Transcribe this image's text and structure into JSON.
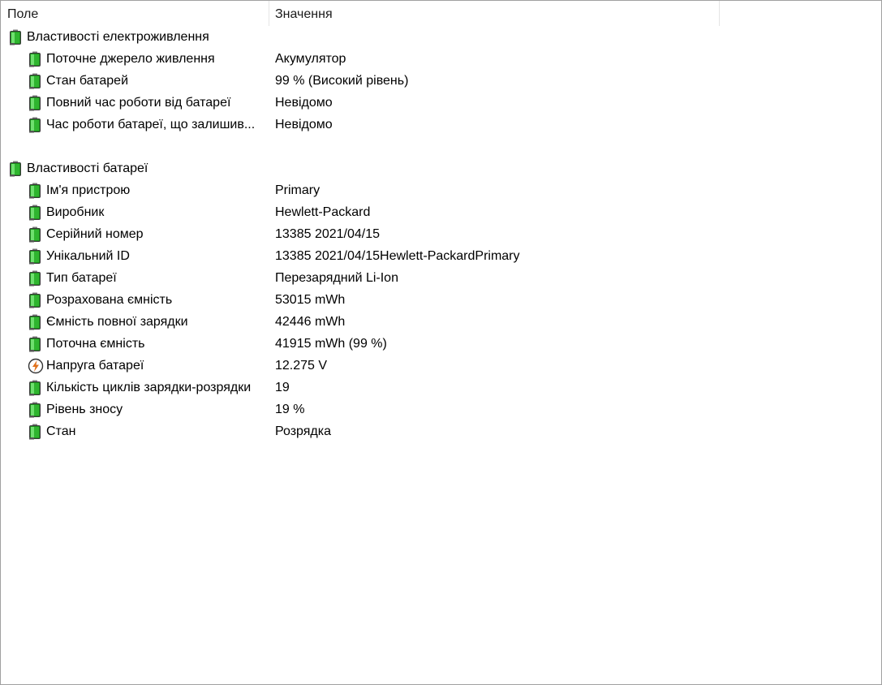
{
  "header": {
    "field_col": "Поле",
    "value_col": "Значення"
  },
  "groups": [
    {
      "title": "Властивості електроживлення",
      "icon": "battery-icon",
      "items": [
        {
          "field": "Поточне джерело живлення",
          "value": "Акумулятор",
          "icon": "battery-icon"
        },
        {
          "field": "Стан батарей",
          "value": "99 % (Високий рівень)",
          "icon": "battery-icon"
        },
        {
          "field": "Повний час роботи від батареї",
          "value": "Невідомо",
          "icon": "battery-icon"
        },
        {
          "field": "Час роботи батареї, що залишив...",
          "value": "Невідомо",
          "icon": "battery-icon"
        }
      ]
    },
    {
      "title": "Властивості батареї",
      "icon": "battery-icon",
      "items": [
        {
          "field": "Ім'я пристрою",
          "value": "Primary",
          "icon": "battery-icon"
        },
        {
          "field": "Виробник",
          "value": "Hewlett-Packard",
          "icon": "battery-icon"
        },
        {
          "field": "Серійний номер",
          "value": "13385 2021/04/15",
          "icon": "battery-icon"
        },
        {
          "field": "Унікальний ID",
          "value": "13385 2021/04/15Hewlett-PackardPrimary",
          "icon": "battery-icon"
        },
        {
          "field": "Тип батареї",
          "value": "Перезарядний Li-Ion",
          "icon": "battery-icon"
        },
        {
          "field": "Розрахована ємність",
          "value": "53015 mWh",
          "icon": "battery-icon"
        },
        {
          "field": "Ємність повної зарядки",
          "value": "42446 mWh",
          "icon": "battery-icon"
        },
        {
          "field": "Поточна ємність",
          "value": "41915 mWh  (99 %)",
          "icon": "battery-icon"
        },
        {
          "field": "Напруга батареї",
          "value": "12.275 V",
          "icon": "voltage-icon"
        },
        {
          "field": "Кількість циклів зарядки-розрядки",
          "value": "19",
          "icon": "battery-icon"
        },
        {
          "field": "Рівень зносу",
          "value": "19 %",
          "icon": "battery-icon"
        },
        {
          "field": "Стан",
          "value": "Розрядка",
          "icon": "battery-icon"
        }
      ]
    }
  ],
  "colors": {
    "battery_green": "#2fb52f",
    "voltage_orange": "#e0701a",
    "border": "#a0a0a0"
  }
}
